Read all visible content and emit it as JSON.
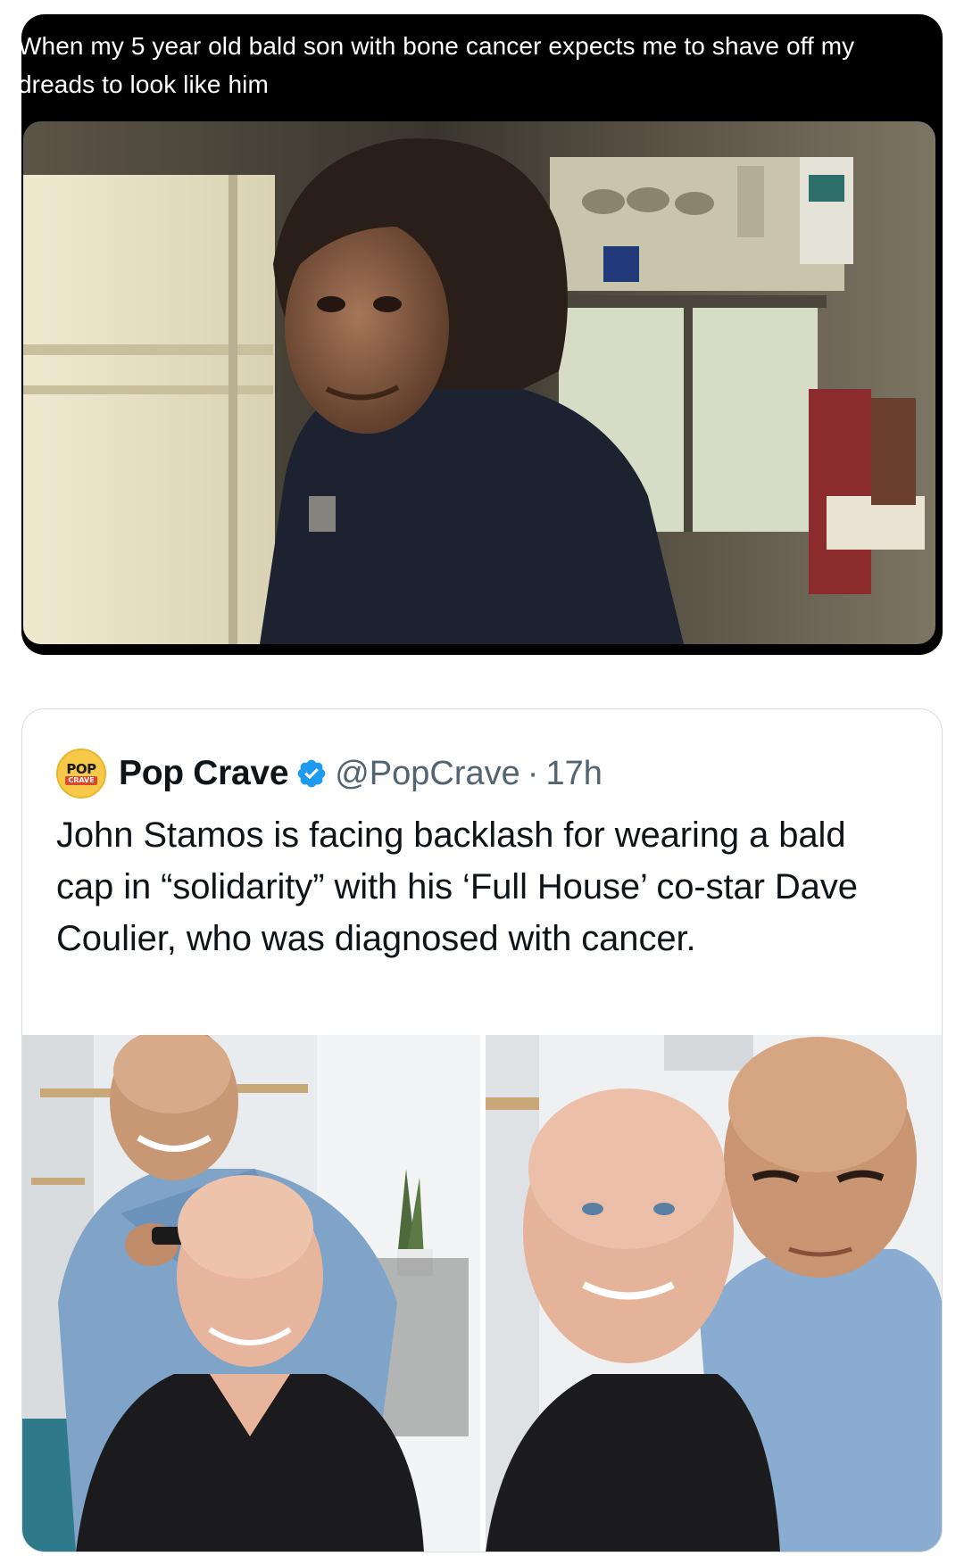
{
  "meme": {
    "caption": "When my 5 year old bald son with bone cancer expects me to shave off my dreads to look like him"
  },
  "tweet": {
    "avatar": {
      "top": "POP",
      "bottom": "CRAVE"
    },
    "display_name": "Pop Crave",
    "verified": true,
    "handle": "@PopCrave",
    "separator": "·",
    "time": "17h",
    "text": "John Stamos is facing backlash for wearing a bald cap in “solidarity” with his ‘Full House’ co-star Dave Coulier, who was diagnosed with cancer.",
    "photos": [
      "photo-shaving",
      "photo-portrait"
    ]
  },
  "colors": {
    "verified": "#1d9bf0",
    "text": "#0f1419",
    "muted": "#536471",
    "border": "#dadde1"
  }
}
